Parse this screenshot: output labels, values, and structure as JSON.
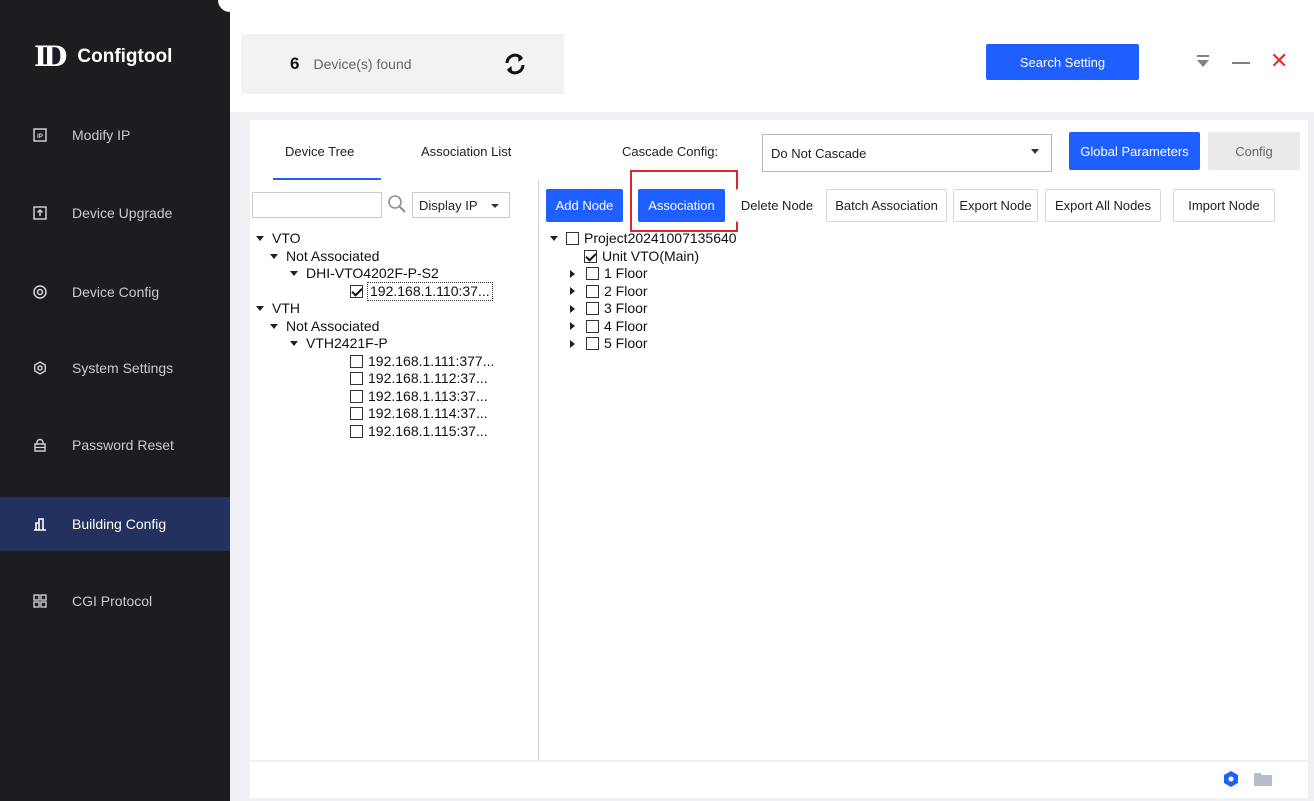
{
  "app": {
    "logo_mark": "D",
    "title": "Configtool"
  },
  "sidebar": {
    "items": [
      {
        "label": "Modify IP",
        "icon": "ip-icon"
      },
      {
        "label": "Device Upgrade",
        "icon": "upgrade-icon"
      },
      {
        "label": "Device Config",
        "icon": "device-config-icon"
      },
      {
        "label": "System Settings",
        "icon": "system-settings-icon"
      },
      {
        "label": "Password Reset",
        "icon": "lock-icon"
      },
      {
        "label": "Building Config",
        "icon": "building-icon",
        "active": true
      },
      {
        "label": "CGI Protocol",
        "icon": "cgi-icon"
      }
    ]
  },
  "topbar": {
    "device_count": "6",
    "device_found_text": "Device(s) found",
    "search_setting_label": "Search Setting"
  },
  "tabs": {
    "device_tree": "Device Tree",
    "association_list": "Association List"
  },
  "cascade": {
    "label": "Cascade Config:",
    "value": "Do Not Cascade"
  },
  "buttons": {
    "global_parameters": "Global Parameters",
    "config": "Config",
    "add_node": "Add Node",
    "association": "Association",
    "delete_node": "Delete Node",
    "batch_association": "Batch Association",
    "export_node": "Export Node",
    "export_all_nodes": "Export All Nodes",
    "import_node": "Import Node"
  },
  "left_pane": {
    "search_value": "",
    "display_select": "Display IP",
    "vto": {
      "label": "VTO",
      "group": "Not Associated",
      "model": "DHI-VTO4202F-P-S2",
      "devices": [
        {
          "ip": "192.168.1.110:37...",
          "checked": true
        }
      ]
    },
    "vth": {
      "label": "VTH",
      "group": "Not Associated",
      "model": "VTH2421F-P",
      "devices": [
        {
          "ip": "192.168.1.111:377...",
          "checked": false
        },
        {
          "ip": "192.168.1.112:37...",
          "checked": false
        },
        {
          "ip": "192.168.1.113:37...",
          "checked": false
        },
        {
          "ip": "192.168.1.114:37...",
          "checked": false
        },
        {
          "ip": "192.168.1.115:37...",
          "checked": false
        }
      ]
    }
  },
  "right_pane": {
    "project": "Project20241007135640",
    "unit": "Unit VTO(Main)",
    "floors": [
      "1 Floor",
      "2 Floor",
      "3 Floor",
      "4 Floor",
      "5 Floor"
    ]
  },
  "colors": {
    "accent": "#1f5fff",
    "sidebar_bg": "#1b1d21",
    "active_nav": "#22315e",
    "highlight": "#e3242b",
    "close": "#e0302a"
  }
}
